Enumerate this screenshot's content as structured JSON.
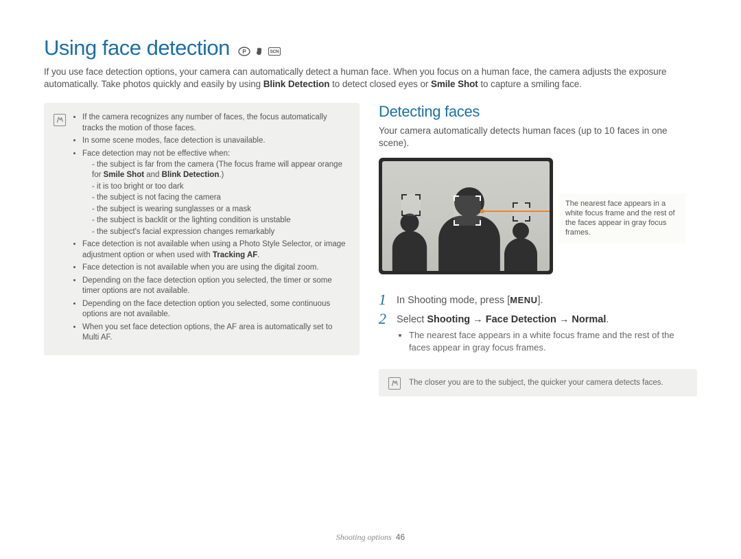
{
  "title": "Using face detection",
  "mode_icons": [
    "P-icon",
    "hand-icon",
    "SCN-icon"
  ],
  "intro_parts": {
    "p1": "If you use face detection options, your camera can automatically detect a human face. When you focus on a human face, the camera adjusts the exposure automatically. Take photos quickly and easily by using ",
    "b1": "Blink Detection",
    "p2": " to detect closed eyes or ",
    "b2": "Smile Shot",
    "p3": " to capture a smiling face."
  },
  "notes": {
    "items": [
      {
        "text": "If the camera recognizes any number of faces, the focus automatically tracks the motion of those faces."
      },
      {
        "text": "In some scene modes, face detection is unavailable."
      },
      {
        "text": "Face detection may not be effective when:",
        "sub": [
          {
            "pre": "the subject is far from the camera (The focus frame will appear orange for ",
            "b1": "Smile Shot",
            "mid": " and ",
            "b2": "Blink Detection",
            "post": ".)"
          },
          {
            "pre": "it is too bright or too dark"
          },
          {
            "pre": "the subject is not facing the camera"
          },
          {
            "pre": "the subject is wearing sunglasses or a mask"
          },
          {
            "pre": "the subject is backlit or the lighting condition is unstable"
          },
          {
            "pre": "the subject's facial expression changes remarkably"
          }
        ]
      },
      {
        "text_pre": "Face detection is not available when using a Photo Style Selector, or image adjustment option or when used with ",
        "b": "Tracking AF",
        "text_post": "."
      },
      {
        "text": "Face detection is not available when you are using the digital zoom."
      },
      {
        "text": "Depending on the face detection option you selected, the timer or some timer options are not available."
      },
      {
        "text": "Depending on the face detection option you selected, some continuous options are not available."
      },
      {
        "text": "When you set face detection options, the AF area is automatically set to Multi AF."
      }
    ]
  },
  "section": {
    "heading": "Detecting faces",
    "intro": "Your camera automatically detects human faces (up to 10 faces in one scene).",
    "callout": "The nearest face appears in a white focus frame and the rest of the faces appear in gray focus frames.",
    "steps": {
      "s1_pre": "In Shooting mode, press [",
      "s1_menu": "MENU",
      "s1_post": "].",
      "s2_pre": "Select ",
      "s2_b": "Shooting → Face Detection → Normal",
      "s2_post": ".",
      "s2_bullet": "The nearest face appears in a white focus frame and the rest of the faces appear in gray focus frames."
    },
    "tip": "The closer you are to the subject, the quicker your camera detects faces."
  },
  "footer": {
    "section": "Shooting options",
    "page": "46"
  }
}
